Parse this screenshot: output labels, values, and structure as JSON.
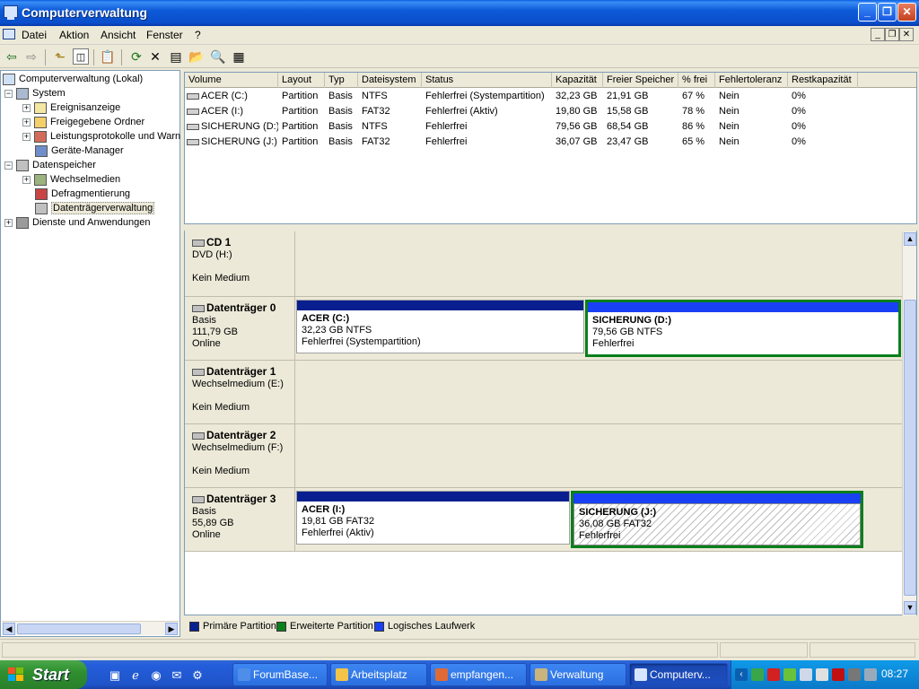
{
  "window": {
    "title": "Computerverwaltung"
  },
  "menu": {
    "items": [
      "Datei",
      "Aktion",
      "Ansicht",
      "Fenster",
      "?"
    ]
  },
  "tree": {
    "root": "Computerverwaltung (Lokal)",
    "system": "System",
    "ereignis": "Ereignisanzeige",
    "ordner": "Freigegebene Ordner",
    "leistung": "Leistungsprotokolle und Warn",
    "geraete": "Geräte-Manager",
    "datenspeicher": "Datenspeicher",
    "wechselmedien": "Wechselmedien",
    "defrag": "Defragmentierung",
    "dtverw": "Datenträgerverwaltung",
    "dienste": "Dienste und Anwendungen"
  },
  "volumes": {
    "headers": [
      "Volume",
      "Layout",
      "Typ",
      "Dateisystem",
      "Status",
      "Kapazität",
      "Freier Speicher",
      "% frei",
      "Fehlertoleranz",
      "Restkapazität"
    ],
    "rows": [
      [
        "ACER (C:)",
        "Partition",
        "Basis",
        "NTFS",
        "Fehlerfrei (Systempartition)",
        "32,23 GB",
        "21,91 GB",
        "67 %",
        "Nein",
        "0%"
      ],
      [
        "ACER (I:)",
        "Partition",
        "Basis",
        "FAT32",
        "Fehlerfrei (Aktiv)",
        "19,80 GB",
        "15,58 GB",
        "78 %",
        "Nein",
        "0%"
      ],
      [
        "SICHERUNG (D:)",
        "Partition",
        "Basis",
        "NTFS",
        "Fehlerfrei",
        "79,56 GB",
        "68,54 GB",
        "86 %",
        "Nein",
        "0%"
      ],
      [
        "SICHERUNG (J:)",
        "Partition",
        "Basis",
        "FAT32",
        "Fehlerfrei",
        "36,07 GB",
        "23,47 GB",
        "65 %",
        "Nein",
        "0%"
      ]
    ]
  },
  "disks": {
    "cd1": {
      "name": "CD 1",
      "l1": "DVD (H:)",
      "l3": "Kein Medium"
    },
    "d0": {
      "name": "Datenträger 0",
      "l1": "Basis",
      "l2": "111,79 GB",
      "l3": "Online",
      "p1": {
        "name": "ACER  (C:)",
        "size": "32,23 GB NTFS",
        "status": "Fehlerfrei (Systempartition)"
      },
      "p2": {
        "name": "SICHERUNG  (D:)",
        "size": "79,56 GB NTFS",
        "status": "Fehlerfrei"
      }
    },
    "d1": {
      "name": "Datenträger 1",
      "l1": "Wechselmedium (E:)",
      "l3": "Kein Medium"
    },
    "d2": {
      "name": "Datenträger 2",
      "l1": "Wechselmedium (F:)",
      "l3": "Kein Medium"
    },
    "d3": {
      "name": "Datenträger 3",
      "l1": "Basis",
      "l2": "55,89 GB",
      "l3": "Online",
      "p1": {
        "name": "ACER  (I:)",
        "size": "19,81 GB FAT32",
        "status": "Fehlerfrei (Aktiv)"
      },
      "p2": {
        "name": "SICHERUNG  (J:)",
        "size": "36,08 GB FAT32",
        "status": "Fehlerfrei"
      }
    }
  },
  "legend": {
    "primary": "Primäre Partition",
    "extended": "Erweiterte Partition",
    "logical": "Logisches Laufwerk"
  },
  "colors": {
    "primary": "#0a1f8f",
    "extended": "#0a7f1c",
    "logical": "#1a40f5"
  },
  "taskbar": {
    "start": "Start",
    "tasks": [
      "ForumBase...",
      "Arbeitsplatz",
      "empfangen...",
      "Verwaltung",
      "Computerv..."
    ],
    "clock": "08:27"
  }
}
